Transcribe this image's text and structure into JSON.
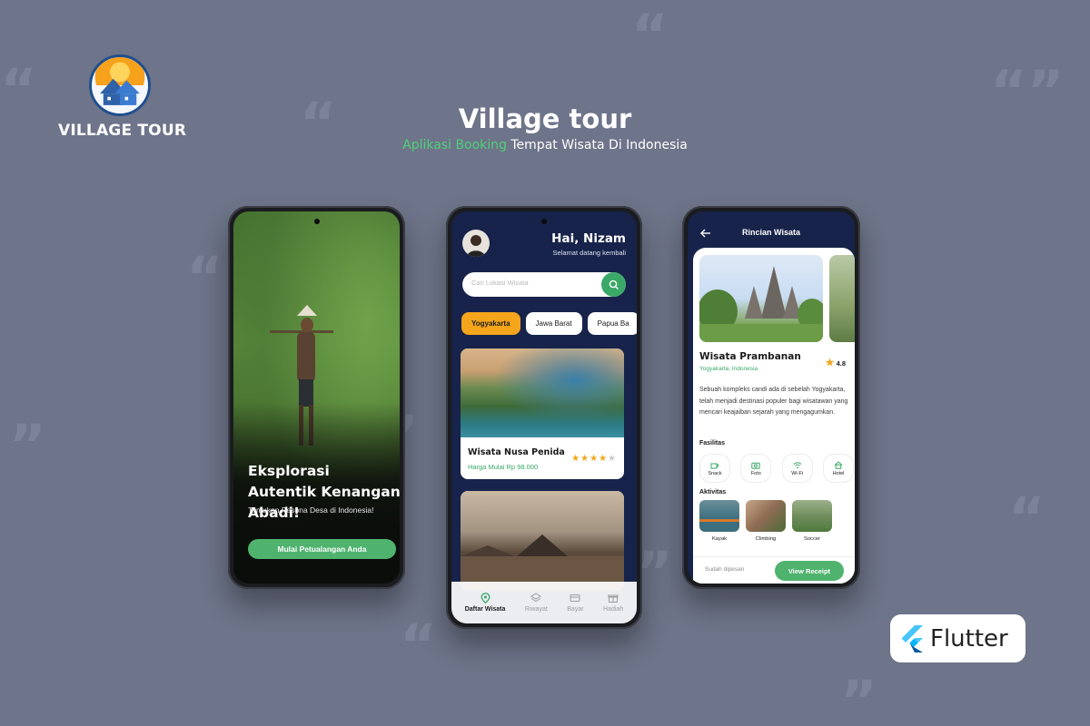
{
  "brand": {
    "logo_text": "VILLAGE TOUR"
  },
  "header": {
    "title": "Village tour",
    "subtitle_accent": "Aplikasi Booking",
    "subtitle_rest": " Tempat Wisata Di Indonesia"
  },
  "colors": {
    "background": "#6e7489",
    "accent_green": "#4fb36e",
    "accent_orange": "#f4a51b",
    "navy": "#17234a"
  },
  "onboarding": {
    "headline": "Eksplorasi Autentik Kenangan Abadi!",
    "tagline": "Temukan Pesona Desa di Indonesia!",
    "cta": "Mulai Petualangan Anda"
  },
  "home": {
    "greeting": "Hai, Nizam",
    "welcome": "Selamat datang kembali",
    "search_placeholder": "Cari Lokasi Wisata",
    "chips": [
      "Yogyakarta",
      "Jawa Barat",
      "Papua Ba"
    ],
    "cards": [
      {
        "title": "Wisata Nusa Penida",
        "price": "Harga Mulai Rp 98.000",
        "rating": 4,
        "max": 5
      }
    ],
    "nav": [
      "Daftar Wisata",
      "Riwayat",
      "Bayar",
      "Hadiah"
    ]
  },
  "detail": {
    "header": "Rincian Wisata",
    "name": "Wisata Prambanan",
    "location": "Yogyakarta, Indonesia",
    "rating": "4.8",
    "description": "Sebuah kompleks candi ada di sebelah Yogyakarta, telah menjadi destinasi populer bagi wisatawan yang mencari keajaiban sejarah yang mengagumkan.",
    "facilities_label": "Fasilitas",
    "facilities": [
      "Snack",
      "Foto",
      "Wi-Fi",
      "Hotel"
    ],
    "activities_label": "Aktivitas",
    "activities": [
      "Kayak",
      "Climbing",
      "Soccer"
    ],
    "footer_status": "Sudah dipesan",
    "receipt_button": "View Receipt"
  },
  "flutter": {
    "label": "Flutter"
  }
}
